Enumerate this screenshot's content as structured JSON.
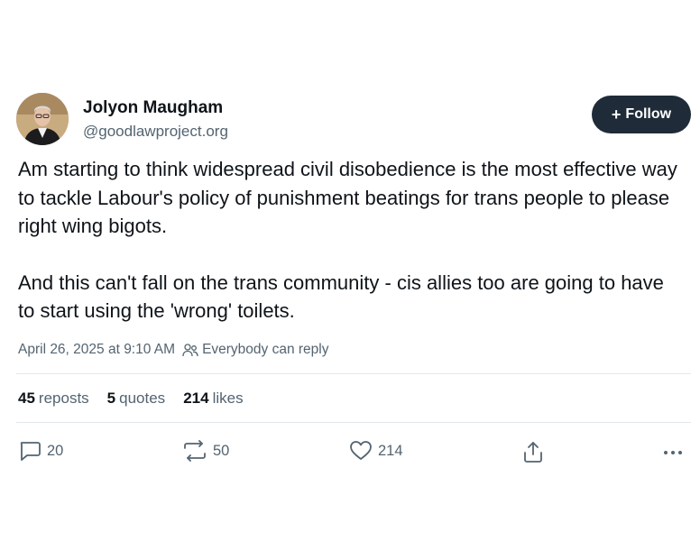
{
  "author": {
    "name": "Jolyon Maugham",
    "handle": "@goodlawproject.org"
  },
  "follow_button": {
    "icon": "plus-icon",
    "label": "Follow"
  },
  "post": {
    "paragraphs": [
      "Am starting to think widespread civil disobedience is the most effective way to tackle Labour's policy of punishment beatings for trans people to please right wing bigots.",
      "And this can't fall on the trans community - cis allies too are going to have to start using the 'wrong' toilets."
    ],
    "timestamp": "April 26, 2025 at 9:10 AM",
    "reply_setting": "Everybody can reply"
  },
  "stats": {
    "reposts_count": "45",
    "reposts_label": "reposts",
    "quotes_count": "5",
    "quotes_label": "quotes",
    "likes_count": "214",
    "likes_label": "likes"
  },
  "actions": {
    "reply_count": "20",
    "repost_count": "50",
    "like_count": "214"
  },
  "colors": {
    "text": "#0f1419",
    "secondary": "#536471",
    "follow_bg": "#1f2b38",
    "divider": "#e4e8eb"
  }
}
